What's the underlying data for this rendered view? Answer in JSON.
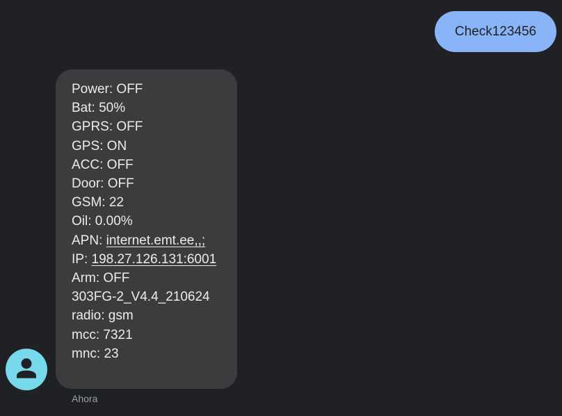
{
  "sent_message": {
    "text": "Check123456"
  },
  "received_message": {
    "lines": [
      "Power: OFF",
      "Bat: 50%",
      "GPRS: OFF",
      "GPS: ON",
      "ACC: OFF",
      "Door: OFF",
      "GSM: 22",
      "Oil: 0.00%"
    ],
    "apn_label": "APN: ",
    "apn_link": "internet.emt.ee,,;",
    "ip_label": "IP: ",
    "ip_link": "198.27.126.131:6001",
    "tail_lines": [
      "Arm: OFF",
      "303FG-2_V4.4_210624",
      "radio: gsm",
      "mcc: 7321",
      "mnc: 23"
    ],
    "timestamp": "Ahora"
  },
  "avatar": {
    "icon": "person-icon",
    "color": "#78d9ec"
  },
  "colors": {
    "background": "#202124",
    "sent_bubble": "#8ab4f8",
    "received_bubble": "#3c3c3e",
    "text_light": "#ececec",
    "timestamp": "#9aa0a6"
  }
}
